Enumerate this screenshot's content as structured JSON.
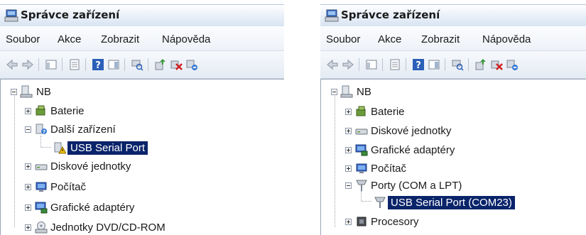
{
  "left": {
    "title": "Správce zařízení",
    "menu": [
      "Soubor",
      "Akce",
      "Zobrazit",
      "Nápověda"
    ],
    "tree": {
      "root": "NB",
      "items": [
        {
          "label": "Baterie",
          "icon": "battery-icon"
        },
        {
          "label": "Další zařízení",
          "icon": "other-devices-icon"
        },
        {
          "label": "USB Serial Port",
          "icon": "unknown-device-warning-icon"
        },
        {
          "label": "Diskové jednotky",
          "icon": "disk-drive-icon"
        },
        {
          "label": "Počítač",
          "icon": "computer-icon"
        },
        {
          "label": "Grafické adaptéry",
          "icon": "display-adapter-icon"
        },
        {
          "label": "Jednotky DVD/CD-ROM",
          "icon": "dvd-drive-icon"
        }
      ]
    }
  },
  "right": {
    "title": "Správce zařízení",
    "menu": [
      "Soubor",
      "Akce",
      "Zobrazit",
      "Nápověda"
    ],
    "tree": {
      "root": "NB",
      "items": [
        {
          "label": "Baterie",
          "icon": "battery-icon"
        },
        {
          "label": "Diskové jednotky",
          "icon": "disk-drive-icon"
        },
        {
          "label": "Grafické adaptéry",
          "icon": "display-adapter-icon"
        },
        {
          "label": "Počítač",
          "icon": "computer-icon"
        },
        {
          "label": "Porty (COM a LPT)",
          "icon": "port-icon"
        },
        {
          "label": "USB Serial Port (COM23)",
          "icon": "port-icon"
        },
        {
          "label": "Procesory",
          "icon": "processor-icon"
        }
      ]
    }
  },
  "colors": {
    "selection": "#0a246a",
    "selection_text": "#ffffff"
  }
}
